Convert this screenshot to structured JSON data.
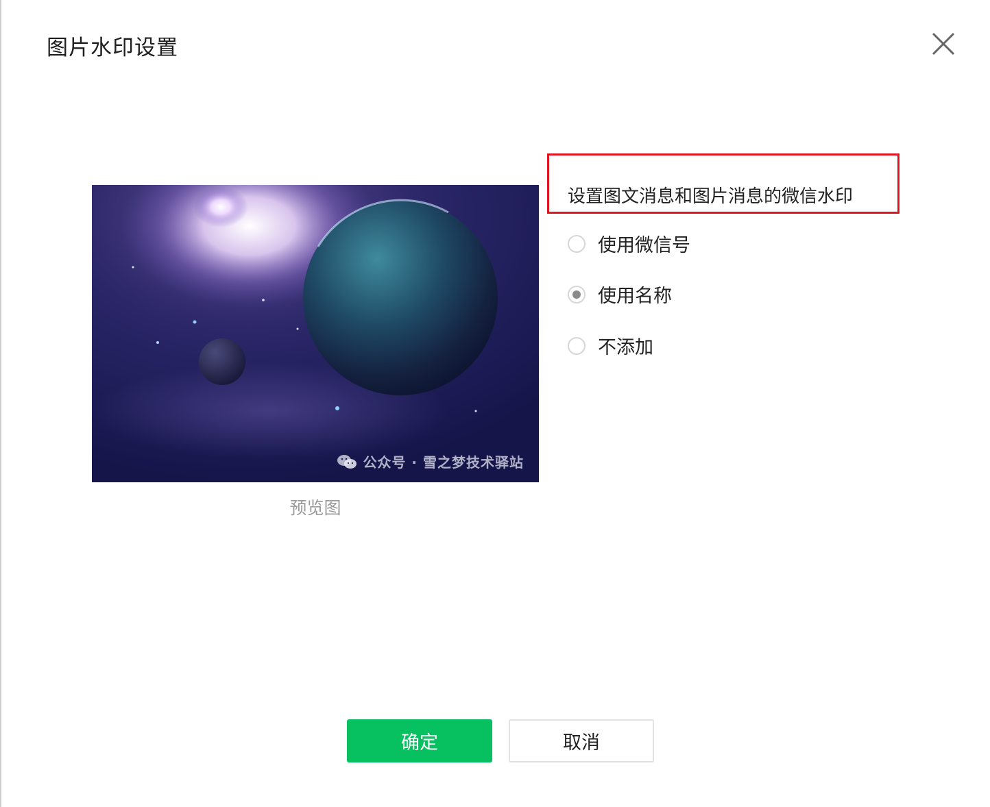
{
  "dialog": {
    "title": "图片水印设置",
    "close_icon": "close-icon"
  },
  "preview": {
    "watermark_text": "公众号 · 雪之梦技术驿站",
    "watermark_icon": "wechat-icon",
    "caption": "预览图"
  },
  "settings": {
    "description": "设置图文消息和图片消息的微信水印",
    "highlight_color": "#e0141e",
    "options": [
      {
        "label": "使用微信号",
        "checked": false
      },
      {
        "label": "使用名称",
        "checked": true
      },
      {
        "label": "不添加",
        "checked": false
      }
    ]
  },
  "footer": {
    "ok_label": "确定",
    "cancel_label": "取消",
    "ok_color": "#07c160"
  }
}
